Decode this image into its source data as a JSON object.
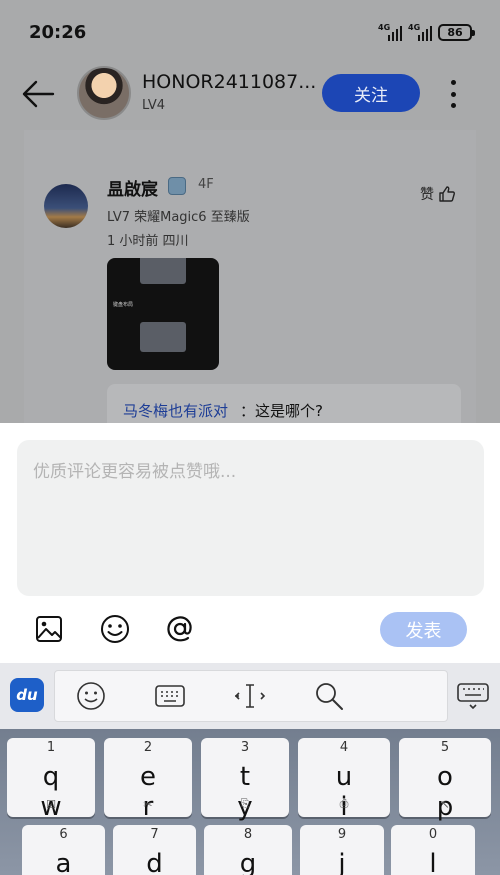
{
  "status_bar": {
    "time": "20:26",
    "network1": "4G",
    "network2": "4G",
    "battery": "86"
  },
  "header": {
    "user_name": "HONOR2411087...",
    "level": "LV4",
    "follow_label": "关注"
  },
  "comment": {
    "author": "昷啟宸",
    "floor": "4F",
    "meta": "LV7   荣耀Magic6 至臻版",
    "time_location": "1 小时前   四川",
    "like_label": "赞",
    "image_caption": "键盘布局",
    "reply_user": "马冬梅也有派对",
    "reply_text": "：这是哪个?"
  },
  "input": {
    "placeholder": "优质评论更容易被点赞哦...",
    "publish_label": "发表"
  },
  "ime": {
    "logo": "du",
    "row1": [
      {
        "num": "1",
        "letters": "q w",
        "sub": "☑"
      },
      {
        "num": "2",
        "letters": "e r",
        "sub": "✂"
      },
      {
        "num": "3",
        "letters": "t y",
        "sub": "⎘"
      },
      {
        "num": "4",
        "letters": "u i",
        "sub": "⎙"
      },
      {
        "num": "5",
        "letters": "o p",
        "sub": "↖"
      }
    ],
    "row2": [
      {
        "num": "6",
        "letters": "a s"
      },
      {
        "num": "7",
        "letters": "d f"
      },
      {
        "num": "8",
        "letters": "g h"
      },
      {
        "num": "9",
        "letters": "j k"
      },
      {
        "num": "0",
        "letters": "l"
      }
    ]
  }
}
